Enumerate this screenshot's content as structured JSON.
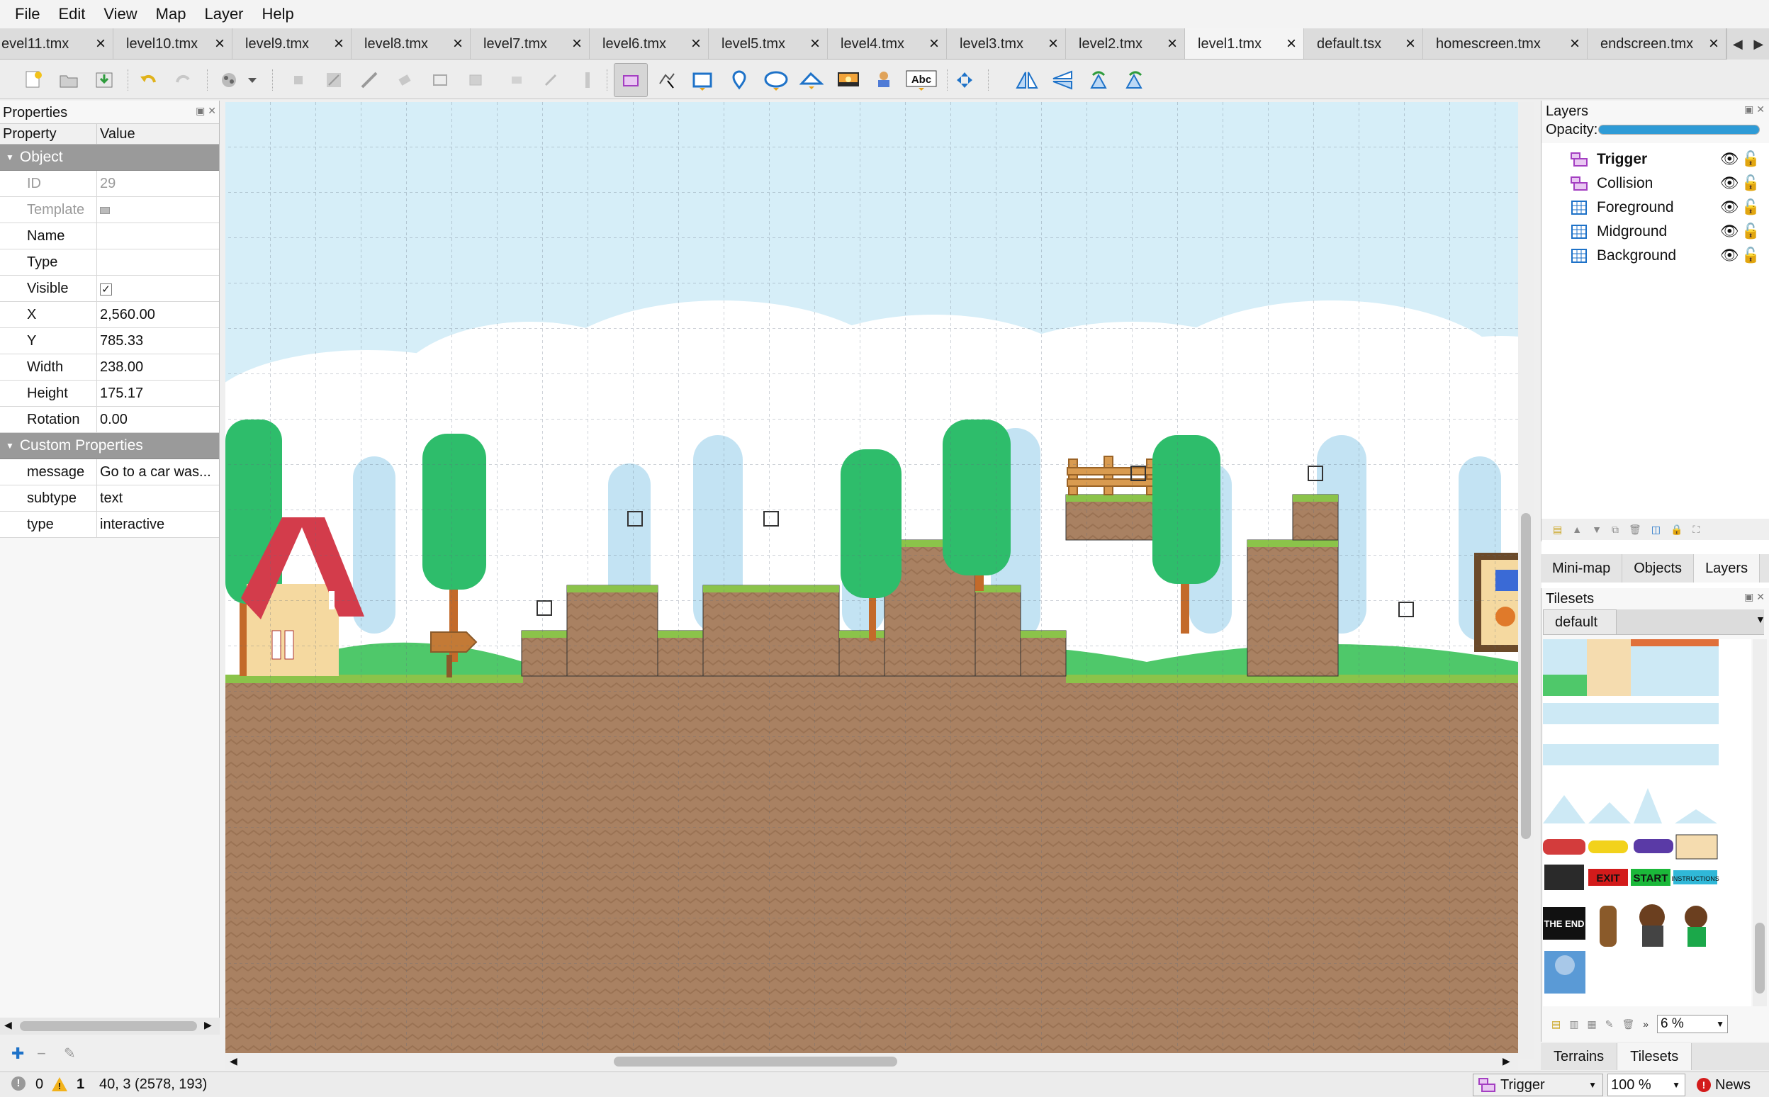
{
  "menu": [
    "File",
    "Edit",
    "View",
    "Map",
    "Layer",
    "Help"
  ],
  "tabs": [
    {
      "label": "evel11.tmx"
    },
    {
      "label": "level10.tmx"
    },
    {
      "label": "level9.tmx"
    },
    {
      "label": "level8.tmx"
    },
    {
      "label": "level7.tmx"
    },
    {
      "label": "level6.tmx"
    },
    {
      "label": "level5.tmx"
    },
    {
      "label": "level4.tmx"
    },
    {
      "label": "level3.tmx"
    },
    {
      "label": "level2.tmx"
    },
    {
      "label": "level1.tmx",
      "active": true
    },
    {
      "label": "default.tsx"
    },
    {
      "label": "homescreen.tmx"
    },
    {
      "label": "endscreen.tmx"
    }
  ],
  "toolbar": {
    "icons": [
      "new-map-icon",
      "open-icon",
      "save-icon",
      "undo-icon",
      "redo-icon",
      "stamp-brush-icon",
      "random-mode-icon",
      "bucket-fill-icon",
      "shape-fill-icon",
      "eraser-icon",
      "rectangle-select-icon",
      "magic-wand-icon",
      "same-tile-select-icon",
      "select-objects-icon",
      "edit-polygons-icon",
      "insert-rectangle-icon",
      "insert-point-icon",
      "insert-ellipse-icon",
      "insert-polygon-icon",
      "insert-tile-icon",
      "insert-template-icon",
      "insert-text-icon",
      "move-icon",
      "flip-horizontal-icon",
      "flip-vertical-icon",
      "rotate-left-icon",
      "rotate-right-icon"
    ],
    "text_tool_label": "Abc"
  },
  "properties": {
    "title": "Properties",
    "col_property": "Property",
    "col_value": "Value",
    "group_object": "Object",
    "rows": [
      {
        "key": "ID",
        "value": "29",
        "grey": true
      },
      {
        "key": "Template",
        "value": "",
        "grey": true
      },
      {
        "key": "Name",
        "value": ""
      },
      {
        "key": "Type",
        "value": ""
      },
      {
        "key": "Visible",
        "value": "✓"
      },
      {
        "key": "X",
        "value": "2,560.00"
      },
      {
        "key": "Y",
        "value": "785.33"
      },
      {
        "key": "Width",
        "value": "238.00"
      },
      {
        "key": "Height",
        "value": "175.17"
      },
      {
        "key": "Rotation",
        "value": "0.00"
      }
    ],
    "group_custom": "Custom Properties",
    "custom_rows": [
      {
        "key": "message",
        "value": "Go to a car was..."
      },
      {
        "key": "subtype",
        "value": "text"
      },
      {
        "key": "type",
        "value": "interactive"
      }
    ]
  },
  "layers": {
    "title": "Layers",
    "opacity_label": "Opacity:",
    "opacity": 1.0,
    "items": [
      {
        "name": "Trigger",
        "kind": "object",
        "bold": true
      },
      {
        "name": "Collision",
        "kind": "object"
      },
      {
        "name": "Foreground",
        "kind": "tile"
      },
      {
        "name": "Midground",
        "kind": "tile"
      },
      {
        "name": "Background",
        "kind": "tile"
      }
    ]
  },
  "mid_tabs": [
    "Mini-map",
    "Objects",
    "Layers"
  ],
  "tilesets": {
    "title": "Tilesets",
    "selected": "default",
    "zoom": "6 %",
    "exit_label": "EXIT",
    "start_label": "START",
    "instructions_label": "INSTRUCTIONS",
    "end_label": "THE END"
  },
  "bottom_tabs": [
    "Terrains",
    "Tilesets"
  ],
  "status": {
    "errors": "0",
    "warnings": "1",
    "coords": "40, 3 (2578, 193)",
    "current_layer": "Trigger",
    "zoom": "100 %",
    "news": "News"
  },
  "colors": {
    "sky": "#d6eef8",
    "dirt": "#a98162",
    "grass": "#8bc34a",
    "tree": "#2ebd6b",
    "accent_selection": "#2e9bd6"
  }
}
